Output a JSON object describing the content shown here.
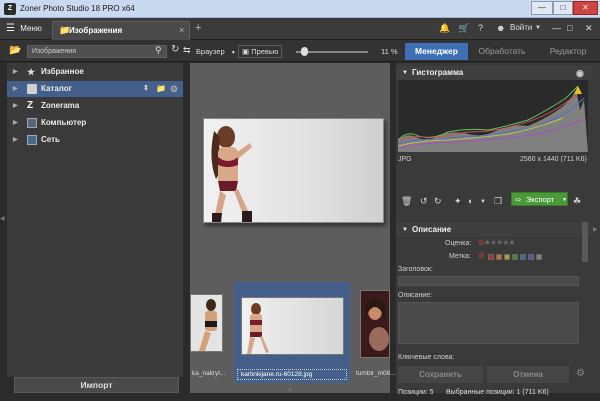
{
  "window": {
    "title": "Zoner Photo Studio 18 PRO x64",
    "app_icon": "Z",
    "controls": [
      "—",
      "□",
      "✕"
    ]
  },
  "topbar": {
    "menu_label": "Меню",
    "tab_label": "Изображения",
    "tab_close": "×",
    "add_tab": "+",
    "login_label": "Войти"
  },
  "toolbar": {
    "search_placeholder": "Изображения",
    "browser_label": "Браузер",
    "preview_label": "Превью",
    "zoom_text": "11 %",
    "zoom_fraction": 0.11
  },
  "modes": [
    {
      "label": "Менеджер",
      "active": true
    },
    {
      "label": "Обработать",
      "active": false
    },
    {
      "label": "Редактор",
      "active": false
    }
  ],
  "navigator": {
    "items": [
      {
        "label": "Избранное",
        "icon": "star-icon"
      },
      {
        "label": "Каталог",
        "icon": "catalog-icon",
        "active": true
      },
      {
        "label": "Zonerama",
        "icon": "zonerama-icon"
      },
      {
        "label": "Компьютер",
        "icon": "computer-icon"
      },
      {
        "label": "Сеть",
        "icon": "network-icon"
      }
    ],
    "import_label": "Импорт"
  },
  "filmstrip": {
    "items": [
      {
        "name": "ka_nakryl..."
      },
      {
        "name": "kartinkijane.ru-60128.jpg",
        "selected": true
      },
      {
        "name": "tumblr_m08..."
      }
    ]
  },
  "histogram": {
    "header": "Гистограмма",
    "format": "JPG",
    "dimensions": "2560 x 1440 (711 K6)"
  },
  "actions": {
    "export_label": "Экспорт"
  },
  "description": {
    "header": "Описание",
    "rating_label": "Оценка:",
    "color_label_label": "Метка:",
    "title_label": "Заголовок:",
    "description_label": "Описание:",
    "keywords_label": "Ключевые слова:",
    "save_label": "Сохранить",
    "cancel_label": "Отмена",
    "label_colors": [
      "#b03030",
      "#c07030",
      "#b0a030",
      "#4a8a3a",
      "#3a6aa0",
      "#6a4aa0",
      "#808080"
    ]
  },
  "status": {
    "positions": "Позиции: 5",
    "selected": "Выбранные позиции: 1 (711 K6)"
  }
}
